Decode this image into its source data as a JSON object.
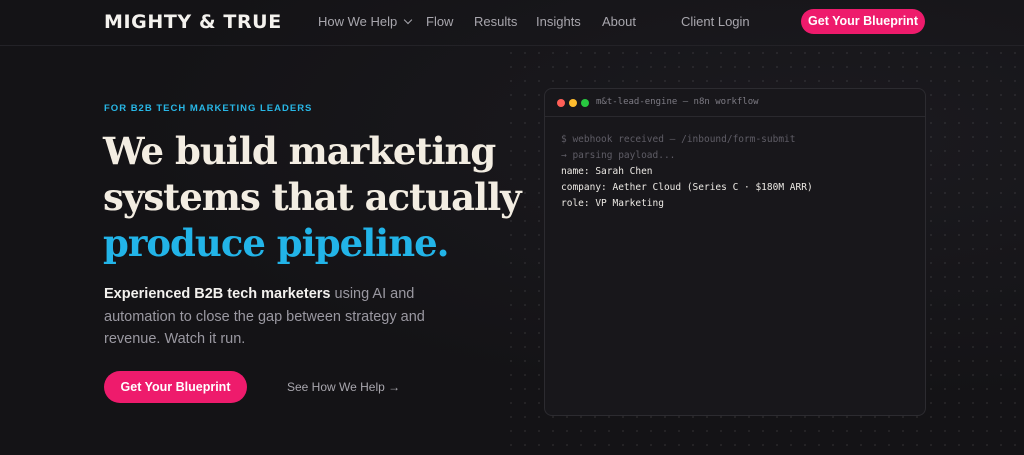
{
  "brand": {
    "logo": "MIGHTY & TRUE"
  },
  "nav": {
    "items": [
      {
        "label": "How We Help"
      },
      {
        "label": "Flow"
      },
      {
        "label": "Results"
      },
      {
        "label": "Insights"
      },
      {
        "label": "About"
      }
    ],
    "client_login": "Client Login",
    "cta": "Get Your Blueprint"
  },
  "hero": {
    "eyebrow": "FOR B2B TECH MARKETING LEADERS",
    "headline_line1": "We build marketing",
    "headline_line2": "systems that actually",
    "headline_accent": "produce pipeline.",
    "sub_strong": "Experienced B2B tech marketers",
    "sub_rest": " using AI and automation to close the gap between strategy and revenue. Watch it run.",
    "cta": "Get Your Blueprint",
    "secondary_link": "See How We Help →"
  },
  "terminal": {
    "title": "m&t-lead-engine — n8n workflow",
    "lines": [
      {
        "text": "$ webhook received — /inbound/form-submit",
        "style": "dim"
      },
      {
        "text": "→ parsing payload...",
        "style": "dim"
      },
      {
        "text": "name: Sarah Chen",
        "style": "bright"
      },
      {
        "text": "company: Aether Cloud (Series C · $180M ARR)",
        "style": "bright"
      },
      {
        "text": "role: VP Marketing",
        "style": "bright"
      }
    ]
  },
  "colors": {
    "accent_pink": "#ee1b6c",
    "accent_cyan": "#22b4e8",
    "background": "#141316"
  }
}
